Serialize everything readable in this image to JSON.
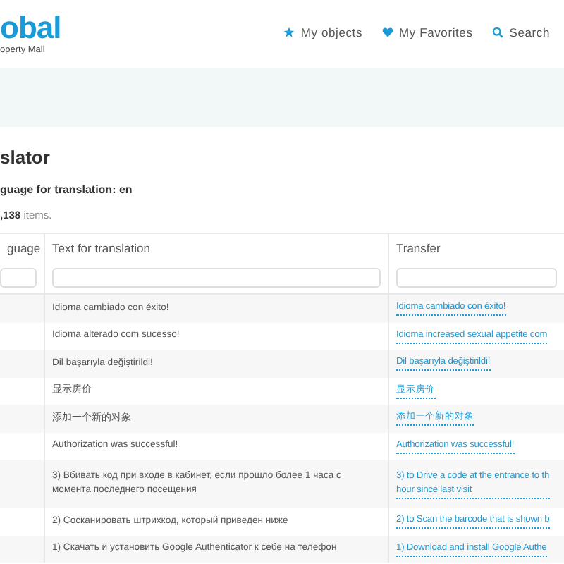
{
  "logo": {
    "name": "obal",
    "tagline": "operty Mall"
  },
  "nav": [
    {
      "kind": "star",
      "label": "My objects"
    },
    {
      "kind": "heart",
      "label": "My Favorites"
    },
    {
      "kind": "search",
      "label": "Search"
    }
  ],
  "page": {
    "title": "slator",
    "language_line": "guage for translation: en",
    "count": ",138",
    "count_suffix": "items."
  },
  "table": {
    "columns": [
      "guage",
      "Text for translation",
      "Transfer"
    ],
    "rows": [
      {
        "text": "Idioma cambiado con éxito!",
        "transfer": [
          "Idioma cambiado con éxito!"
        ]
      },
      {
        "text": "Idioma alterado com sucesso!",
        "transfer": [
          "Idioma increased sexual appetite com"
        ]
      },
      {
        "text": "Dil başarıyla değiştirildi!",
        "transfer": [
          "Dil başarıyla değiştirildi!"
        ]
      },
      {
        "text": "显示房价",
        "transfer": [
          "显示房价"
        ]
      },
      {
        "text": "添加一个新的对象",
        "transfer": [
          "添加一个新的对象"
        ]
      },
      {
        "text": "Authorization was successful!",
        "transfer": [
          "Authorization was successful!"
        ]
      },
      {
        "text": "3) Вбивать код при входе в кабинет, если прошло более 1 часа с момента последнего посещения",
        "transfer": [
          "3) to Drive a code at the entrance to th",
          "hour since last visit"
        ]
      },
      {
        "text": "2) Сосканировать штрихкод, который приведен ниже",
        "transfer": [
          "2) to Scan the barcode that is shown b"
        ]
      },
      {
        "text": "1) Скачать и установить Google Authenticator к себе на телефон",
        "transfer": [
          "1) Download and install Google Authe"
        ]
      }
    ]
  }
}
